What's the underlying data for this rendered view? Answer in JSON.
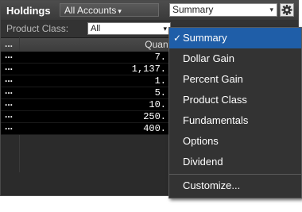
{
  "header": {
    "title": "Holdings",
    "account_button": "All Accounts",
    "view_select_value": "Summary"
  },
  "filter": {
    "label": "Product Class:",
    "value": "All"
  },
  "table": {
    "more_label": "...",
    "quantity_header": "Quant",
    "rows": [
      {
        "more": "...",
        "quantity": "7."
      },
      {
        "more": "...",
        "quantity": "1,137."
      },
      {
        "more": "...",
        "quantity": "1."
      },
      {
        "more": "...",
        "quantity": "5."
      },
      {
        "more": "...",
        "quantity": "10."
      },
      {
        "more": "...",
        "quantity": "250."
      },
      {
        "more": "...",
        "quantity": "400."
      }
    ]
  },
  "menu": {
    "items": [
      {
        "label": "Summary",
        "selected": true
      },
      {
        "label": "Dollar Gain",
        "selected": false
      },
      {
        "label": "Percent Gain",
        "selected": false
      },
      {
        "label": "Product Class",
        "selected": false
      },
      {
        "label": "Fundamentals",
        "selected": false
      },
      {
        "label": "Options",
        "selected": false
      },
      {
        "label": "Dividend",
        "selected": false
      }
    ],
    "customize": "Customize..."
  },
  "colors": {
    "menu_highlight": "#1f5ea8",
    "background": "#000000"
  }
}
